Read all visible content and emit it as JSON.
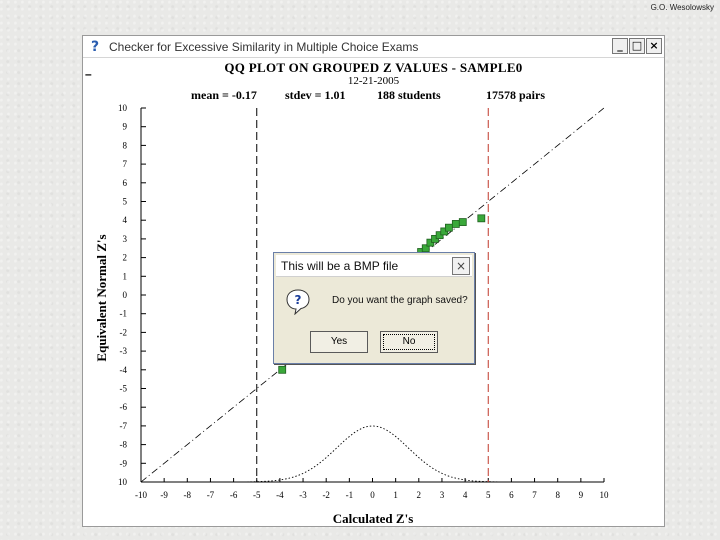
{
  "credit": "G.O. Wesolowsky",
  "window": {
    "title": "Checker for Excessive Similarity in Multiple Choice Exams",
    "controls": {
      "minimize": "_",
      "maximize": "□",
      "close": "×"
    }
  },
  "chart_header": {
    "title": "QQ PLOT ON GROUPED Z VALUES - SAMPLE0",
    "date": "12-21-2005",
    "mean": "mean = -0.17",
    "stdev": "stdev = 1.01",
    "students": "188 students",
    "pairs": "17578 pairs"
  },
  "colors": {
    "points_fill": "#3aa83a",
    "points_stroke": "#1f5f1f",
    "right_line": "#c0392b",
    "left_line": "#000000"
  },
  "chart_data": {
    "type": "scatter",
    "xlabel": "Calculated Z's",
    "ylabel": "Equivalent Normal Z's",
    "xlim": [
      -10,
      10
    ],
    "ylim": [
      -10,
      10
    ],
    "x_ticks": [
      "-10",
      "-9",
      "-8",
      "-7",
      "-6",
      "-5",
      "-4",
      "-3",
      "-2",
      "-1",
      "0",
      "1",
      "2",
      "3",
      "4",
      "5",
      "6",
      "7",
      "8",
      "9",
      "10"
    ],
    "y_ticks": [
      "10",
      "9",
      "8",
      "7",
      "6",
      "5",
      "4",
      "3",
      "2",
      "1",
      "0",
      "-1",
      "-2",
      "-3",
      "-4",
      "-5",
      "-6",
      "-7",
      "-8",
      "-9",
      "10"
    ],
    "reference_line": {
      "style": "dash-dot",
      "from": [
        -10,
        -10
      ],
      "to": [
        10,
        10
      ]
    },
    "vertical_lines": [
      {
        "x": -5,
        "color": "#000000",
        "style": "dashed"
      },
      {
        "x": 5,
        "color": "#c0392b",
        "style": "dashed"
      }
    ],
    "points": [
      {
        "x": -3.9,
        "y": -4.0
      },
      {
        "x": 2.1,
        "y": 2.3
      },
      {
        "x": 2.3,
        "y": 2.5
      },
      {
        "x": 2.5,
        "y": 2.8
      },
      {
        "x": 2.7,
        "y": 3.0
      },
      {
        "x": 2.9,
        "y": 3.2
      },
      {
        "x": 3.1,
        "y": 3.4
      },
      {
        "x": 3.3,
        "y": 3.6
      },
      {
        "x": 3.6,
        "y": 3.8
      },
      {
        "x": 3.9,
        "y": 3.9
      },
      {
        "x": 4.7,
        "y": 4.1
      }
    ],
    "density_curve": {
      "style": "dotted",
      "center": 0,
      "peak_y": -7,
      "baseline_y": -10
    }
  },
  "dialog": {
    "title": "This will be a BMP file",
    "close": "×",
    "message": "Do you want the graph saved?",
    "yes": "Yes",
    "no": "No"
  }
}
